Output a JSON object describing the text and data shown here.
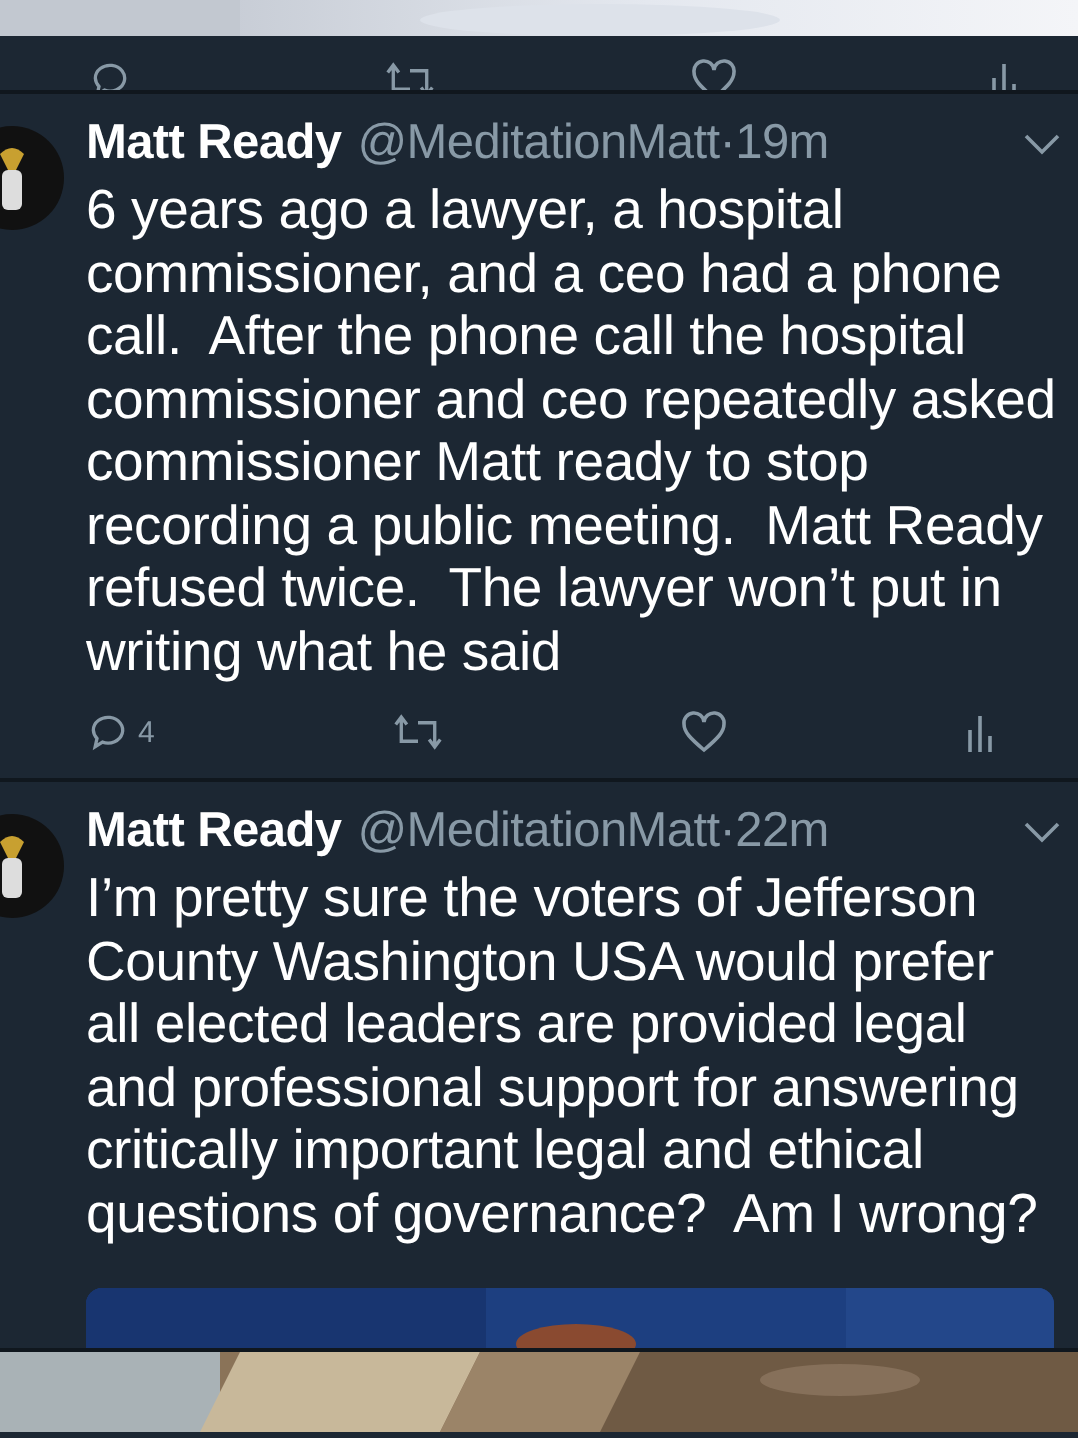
{
  "tweets": [
    {
      "name": "Matt Ready",
      "handle": "@MeditationMatt",
      "separator": "·",
      "time": "19m",
      "text": "6 years ago a lawyer, a hospital commissioner, and a ceo had a phone call.  After the phone call the hospital commissioner and ceo repeatedly asked commissioner Matt ready to stop recording a public meeting.  Matt Ready refused twice.  The lawyer won’t put in writing what he said",
      "reply_count": "4"
    },
    {
      "name": "Matt Ready",
      "handle": "@MeditationMatt",
      "separator": "·",
      "time": "22m",
      "text": "I’m pretty sure the voters of Jefferson County Washington USA would prefer all elected leaders are provided legal and professional support for answering critically important legal and ethical questions of governance?  Am I wrong?"
    }
  ]
}
